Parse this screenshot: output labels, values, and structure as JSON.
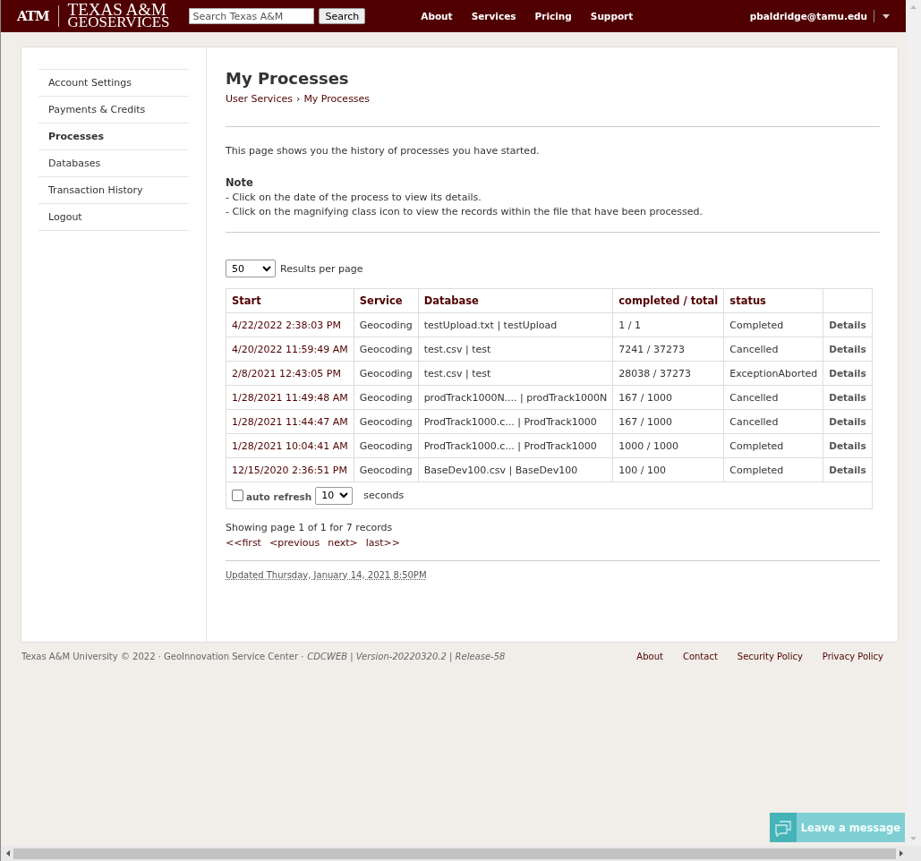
{
  "header": {
    "logo_mark": "ATM",
    "logo_line1": "TEXAS A&M",
    "logo_line2": "GEOSERVICES",
    "search": {
      "placeholder": "Search Texas A&M",
      "button": "Search"
    },
    "nav": [
      "About",
      "Services",
      "Pricing",
      "Support"
    ],
    "user": "pbaldridge@tamu.edu"
  },
  "sidebar": {
    "items": [
      {
        "label": "Account Settings",
        "selected": false
      },
      {
        "label": "Payments & Credits",
        "selected": false
      },
      {
        "label": "Processes",
        "selected": true
      },
      {
        "label": "Databases",
        "selected": false
      },
      {
        "label": "Transaction History",
        "selected": false
      },
      {
        "label": "Logout",
        "selected": false
      }
    ]
  },
  "page": {
    "title": "My Processes",
    "breadcrumb": [
      "User Services",
      "›",
      "My Processes"
    ],
    "intro": "This page shows you the history of processes you have started.",
    "note_title": "Note",
    "notes": [
      "- Click on the date of the process to view its details.",
      "- Click on the magnifying class icon to view the records within the file that have been processed."
    ],
    "per_page": {
      "value": "50",
      "label": "Results per page"
    },
    "table": {
      "columns": [
        "Start",
        "Service",
        "Database",
        "completed / total",
        "status"
      ],
      "rows": [
        {
          "start": "4/22/2022 2:38:03 PM",
          "service": "Geocoding",
          "database": "testUpload.txt | testUpload",
          "progress": "1 / 1",
          "status": "Completed",
          "action": "Details"
        },
        {
          "start": "4/20/2022 11:59:49 AM",
          "service": "Geocoding",
          "database": "test.csv | test",
          "progress": "7241 / 37273",
          "status": "Cancelled",
          "action": "Details"
        },
        {
          "start": "2/8/2021 12:43:05 PM",
          "service": "Geocoding",
          "database": "test.csv | test",
          "progress": "28038 / 37273",
          "status": "ExceptionAborted",
          "action": "Details"
        },
        {
          "start": "1/28/2021 11:49:48 AM",
          "service": "Geocoding",
          "database": "prodTrack1000N.... | prodTrack1000N",
          "progress": "167 / 1000",
          "status": "Cancelled",
          "action": "Details"
        },
        {
          "start": "1/28/2021 11:44:47 AM",
          "service": "Geocoding",
          "database": "ProdTrack1000.c... | ProdTrack1000",
          "progress": "167 / 1000",
          "status": "Cancelled",
          "action": "Details"
        },
        {
          "start": "1/28/2021 10:04:41 AM",
          "service": "Geocoding",
          "database": "ProdTrack1000.c... | ProdTrack1000",
          "progress": "1000 / 1000",
          "status": "Completed",
          "action": "Details"
        },
        {
          "start": "12/15/2020 2:36:51 PM",
          "service": "Geocoding",
          "database": "BaseDev100.csv | BaseDev100",
          "progress": "100 / 100",
          "status": "Completed",
          "action": "Details"
        }
      ],
      "auto_refresh": {
        "label": "auto refresh",
        "checked": false,
        "interval": "10",
        "unit": "seconds"
      }
    },
    "summary": "Showing page 1 of 1 for 7 records",
    "pager": [
      "<<first",
      "<previous",
      "next>",
      "last>>"
    ],
    "updated": "Updated Thursday, January 14, 2021 8:50PM"
  },
  "footer": {
    "text": "Texas A&M University © 2022 · GeoInnovation Service Center ·",
    "version": "CDCWEB | Version-20220320.2 | Release-58",
    "links": [
      "About",
      "Contact",
      "Security Policy",
      "Privacy Policy"
    ]
  },
  "chat": {
    "label": "Leave a message"
  }
}
